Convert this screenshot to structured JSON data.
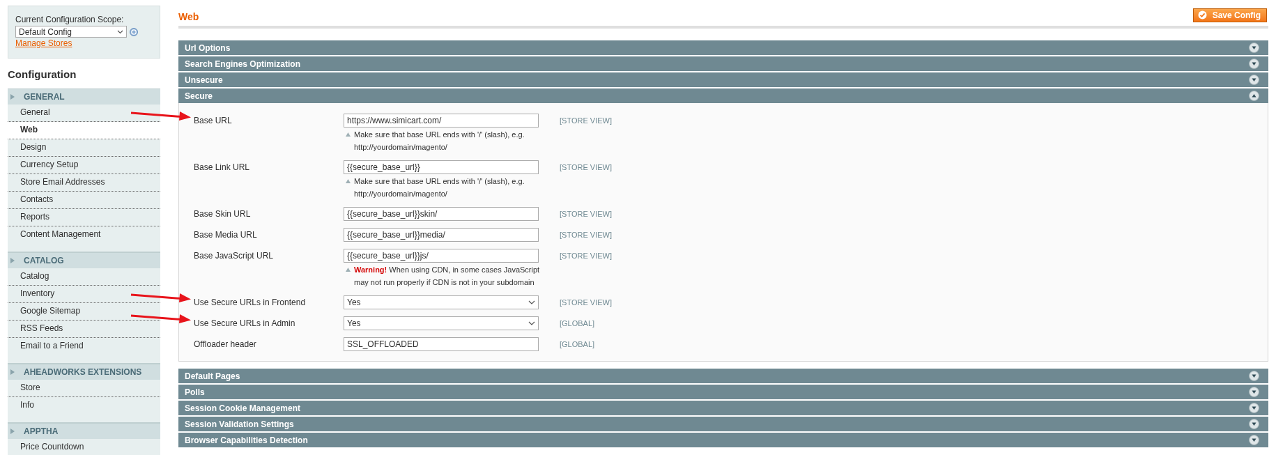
{
  "sidebar": {
    "scope_label": "Current Configuration Scope:",
    "scope_value": "Default Config",
    "manage_link": "Manage Stores",
    "title": "Configuration",
    "groups": [
      {
        "title": "GENERAL",
        "items": [
          {
            "label": "General",
            "selected": false
          },
          {
            "label": "Web",
            "selected": true
          },
          {
            "label": "Design",
            "selected": false
          },
          {
            "label": "Currency Setup",
            "selected": false
          },
          {
            "label": "Store Email Addresses",
            "selected": false
          },
          {
            "label": "Contacts",
            "selected": false
          },
          {
            "label": "Reports",
            "selected": false
          },
          {
            "label": "Content Management",
            "selected": false
          }
        ]
      },
      {
        "title": "CATALOG",
        "items": [
          {
            "label": "Catalog",
            "selected": false
          },
          {
            "label": "Inventory",
            "selected": false
          },
          {
            "label": "Google Sitemap",
            "selected": false
          },
          {
            "label": "RSS Feeds",
            "selected": false
          },
          {
            "label": "Email to a Friend",
            "selected": false
          }
        ]
      },
      {
        "title": "AHEADWORKS EXTENSIONS",
        "items": [
          {
            "label": "Store",
            "selected": false
          },
          {
            "label": "Info",
            "selected": false
          }
        ]
      },
      {
        "title": "APPTHA",
        "items": [
          {
            "label": "Price Countdown",
            "selected": false
          }
        ]
      }
    ]
  },
  "page": {
    "title": "Web",
    "save_button": "Save Config"
  },
  "sections": [
    {
      "title": "Url Options",
      "expanded": false
    },
    {
      "title": "Search Engines Optimization",
      "expanded": false
    },
    {
      "title": "Unsecure",
      "expanded": false
    },
    {
      "title": "Secure",
      "expanded": true,
      "fields": [
        {
          "kind": "text",
          "label": "Base URL",
          "value": "https://www.simicart.com/",
          "scope": "[STORE VIEW]",
          "hint": "Make sure that base URL ends with '/' (slash), e.g. http://yourdomain/magento/",
          "arrow": true
        },
        {
          "kind": "text",
          "label": "Base Link URL",
          "value": "{{secure_base_url}}",
          "scope": "[STORE VIEW]",
          "hint": "Make sure that base URL ends with '/' (slash), e.g. http://yourdomain/magento/",
          "arrow": false
        },
        {
          "kind": "text",
          "label": "Base Skin URL",
          "value": "{{secure_base_url}}skin/",
          "scope": "[STORE VIEW]",
          "arrow": false
        },
        {
          "kind": "text",
          "label": "Base Media URL",
          "value": "{{secure_base_url}}media/",
          "scope": "[STORE VIEW]",
          "arrow": false
        },
        {
          "kind": "text",
          "label": "Base JavaScript URL",
          "value": "{{secure_base_url}}js/",
          "scope": "[STORE VIEW]",
          "hint": "**Warning!** When using CDN, in some cases JavaScript may not run properly if CDN is not in your subdomain",
          "arrow": false
        },
        {
          "kind": "select",
          "label": "Use Secure URLs in Frontend",
          "value": "Yes",
          "scope": "[STORE VIEW]",
          "arrow": true
        },
        {
          "kind": "select",
          "label": "Use Secure URLs in Admin",
          "value": "Yes",
          "scope": "[GLOBAL]",
          "arrow": true
        },
        {
          "kind": "text",
          "label": "Offloader header",
          "value": "SSL_OFFLOADED",
          "scope": "[GLOBAL]",
          "arrow": false
        }
      ]
    },
    {
      "title": "Default Pages",
      "expanded": false
    },
    {
      "title": "Polls",
      "expanded": false
    },
    {
      "title": "Session Cookie Management",
      "expanded": false
    },
    {
      "title": "Session Validation Settings",
      "expanded": false
    },
    {
      "title": "Browser Capabilities Detection",
      "expanded": false
    }
  ]
}
